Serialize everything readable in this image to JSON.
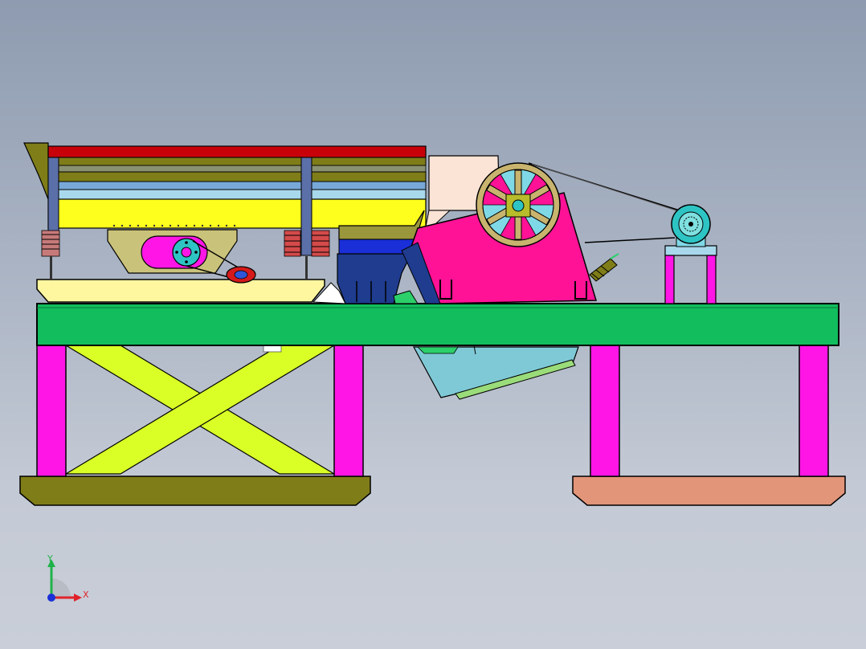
{
  "triad": {
    "y_label": "Y",
    "x_label": "X",
    "y_color": "#1fb24a",
    "x_color": "#e0222a",
    "z_color": "#1a2fd8"
  },
  "model": {
    "frame_color": "#12bd5e",
    "leg_color": "#ff16e6",
    "brace_color": "#d9ff26",
    "left_base_color": "#7f7d18",
    "right_base_color": "#e29579",
    "feeder_color": "#ffff1e",
    "crusher_color": "#ff1296",
    "flywheel_color": "#c8b46e",
    "motor_color": "#2ec4c4",
    "hopper_color": "#1f3c8f"
  }
}
